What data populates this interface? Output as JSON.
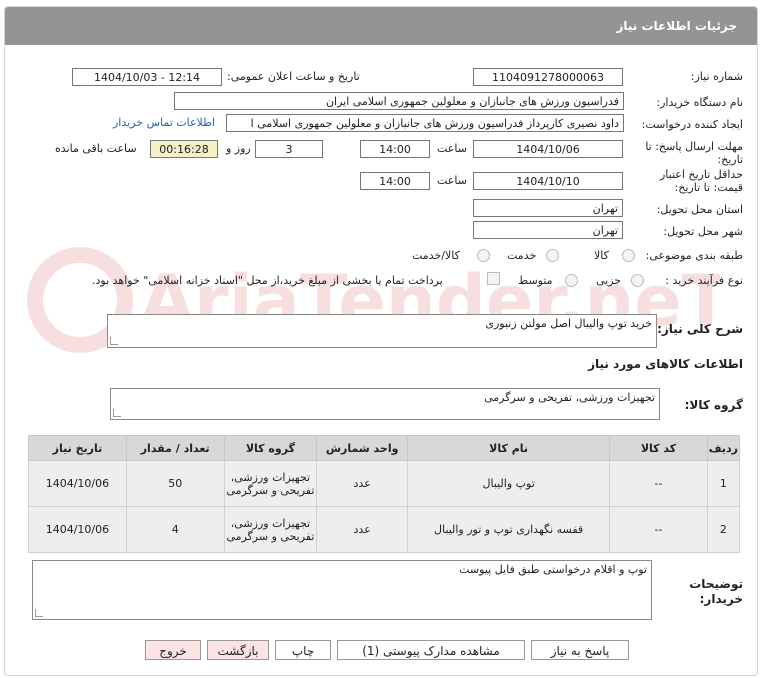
{
  "header": {
    "title": "جزئیات اطلاعات نیاز"
  },
  "fields": {
    "need_number_label": "شماره نیاز:",
    "need_number": "1104091278000063",
    "announce_label": "تاریخ و ساعت اعلان عمومی:",
    "announce_value": "1404/10/03 - 12:14",
    "buyer_org_label": "نام دستگاه خریدار:",
    "buyer_org": "فدراسیون ورزش های جانبازان و معلولین جمهوری اسلامی ایران",
    "creator_label": "ایجاد کننده درخواست:",
    "creator": "داود نصیری کارپرداز فدراسیون ورزش های جانبازان و معلولین جمهوری اسلامی ا",
    "contact_link": "اطلاعات تماس خریدار",
    "deadline_label_1": "مهلت ارسال پاسخ: تا",
    "deadline_label_2": "تاریخ:",
    "deadline_date": "1404/10/06",
    "time_label": "ساعت",
    "deadline_time": "14:00",
    "days_value": "3",
    "days_label": "روز و",
    "remaining_time": "00:16:28",
    "remaining_label": "ساعت باقی مانده",
    "validity_label_1": "حداقل تاریخ اعتبار",
    "validity_label_2": "قیمت: تا تاریخ:",
    "validity_date": "1404/10/10",
    "validity_time": "14:00",
    "province_label": "استان محل تحویل:",
    "province": "تهران",
    "city_label": "شهر محل تحویل:",
    "city": "تهران",
    "category_label": "طبقه بندی موضوعی:",
    "category_options": [
      "کالا",
      "خدمت",
      "کالا/خدمت"
    ],
    "purchase_type_label": "نوع فرآیند خرید :",
    "purchase_options": [
      "جزیی",
      "متوسط"
    ],
    "payment_note": "پرداخت تمام یا بخشی از مبلغ خرید،از محل \"اسناد خزانه اسلامی\" خواهد بود."
  },
  "description": {
    "label": "شرح کلی نیاز:",
    "value": "خرید توپ والیبال اصل مولتن زنبوری"
  },
  "goods_info": {
    "heading": "اطلاعات کالاهای مورد نیاز",
    "group_label": "گروه کالا:",
    "group_value": "تجهیزات ورزشی، تفریحی و سرگرمی"
  },
  "table": {
    "headers": [
      "ردیف",
      "کد کالا",
      "نام کالا",
      "واحد شمارش",
      "گروه کالا",
      "تعداد / مقدار",
      "تاریخ نیاز"
    ],
    "rows": [
      {
        "index": "1",
        "code": "--",
        "name": "توپ والیبال",
        "unit": "عدد",
        "group": "تجهیزات ورزشی، تفریحی و سرگرمی",
        "qty": "50",
        "date": "1404/10/06"
      },
      {
        "index": "2",
        "code": "--",
        "name": "قفسه نگهداری توپ و تور والیبال",
        "unit": "عدد",
        "group": "تجهیزات ورزشی، تفریحی و سرگرمی",
        "qty": "4",
        "date": "1404/10/06"
      }
    ]
  },
  "buyer_notes": {
    "label_1": "توضیحات",
    "label_2": "خریدار:",
    "value": "توپ و اقلام درخواستی طبق فایل پیوست"
  },
  "buttons": {
    "reply": "پاسخ به نیاز",
    "attachments": "مشاهده مدارک پیوستی (1)",
    "print": "چاپ",
    "back": "بازگشت",
    "exit": "خروج"
  },
  "watermark": {
    "text": "AriaTender.neT"
  }
}
